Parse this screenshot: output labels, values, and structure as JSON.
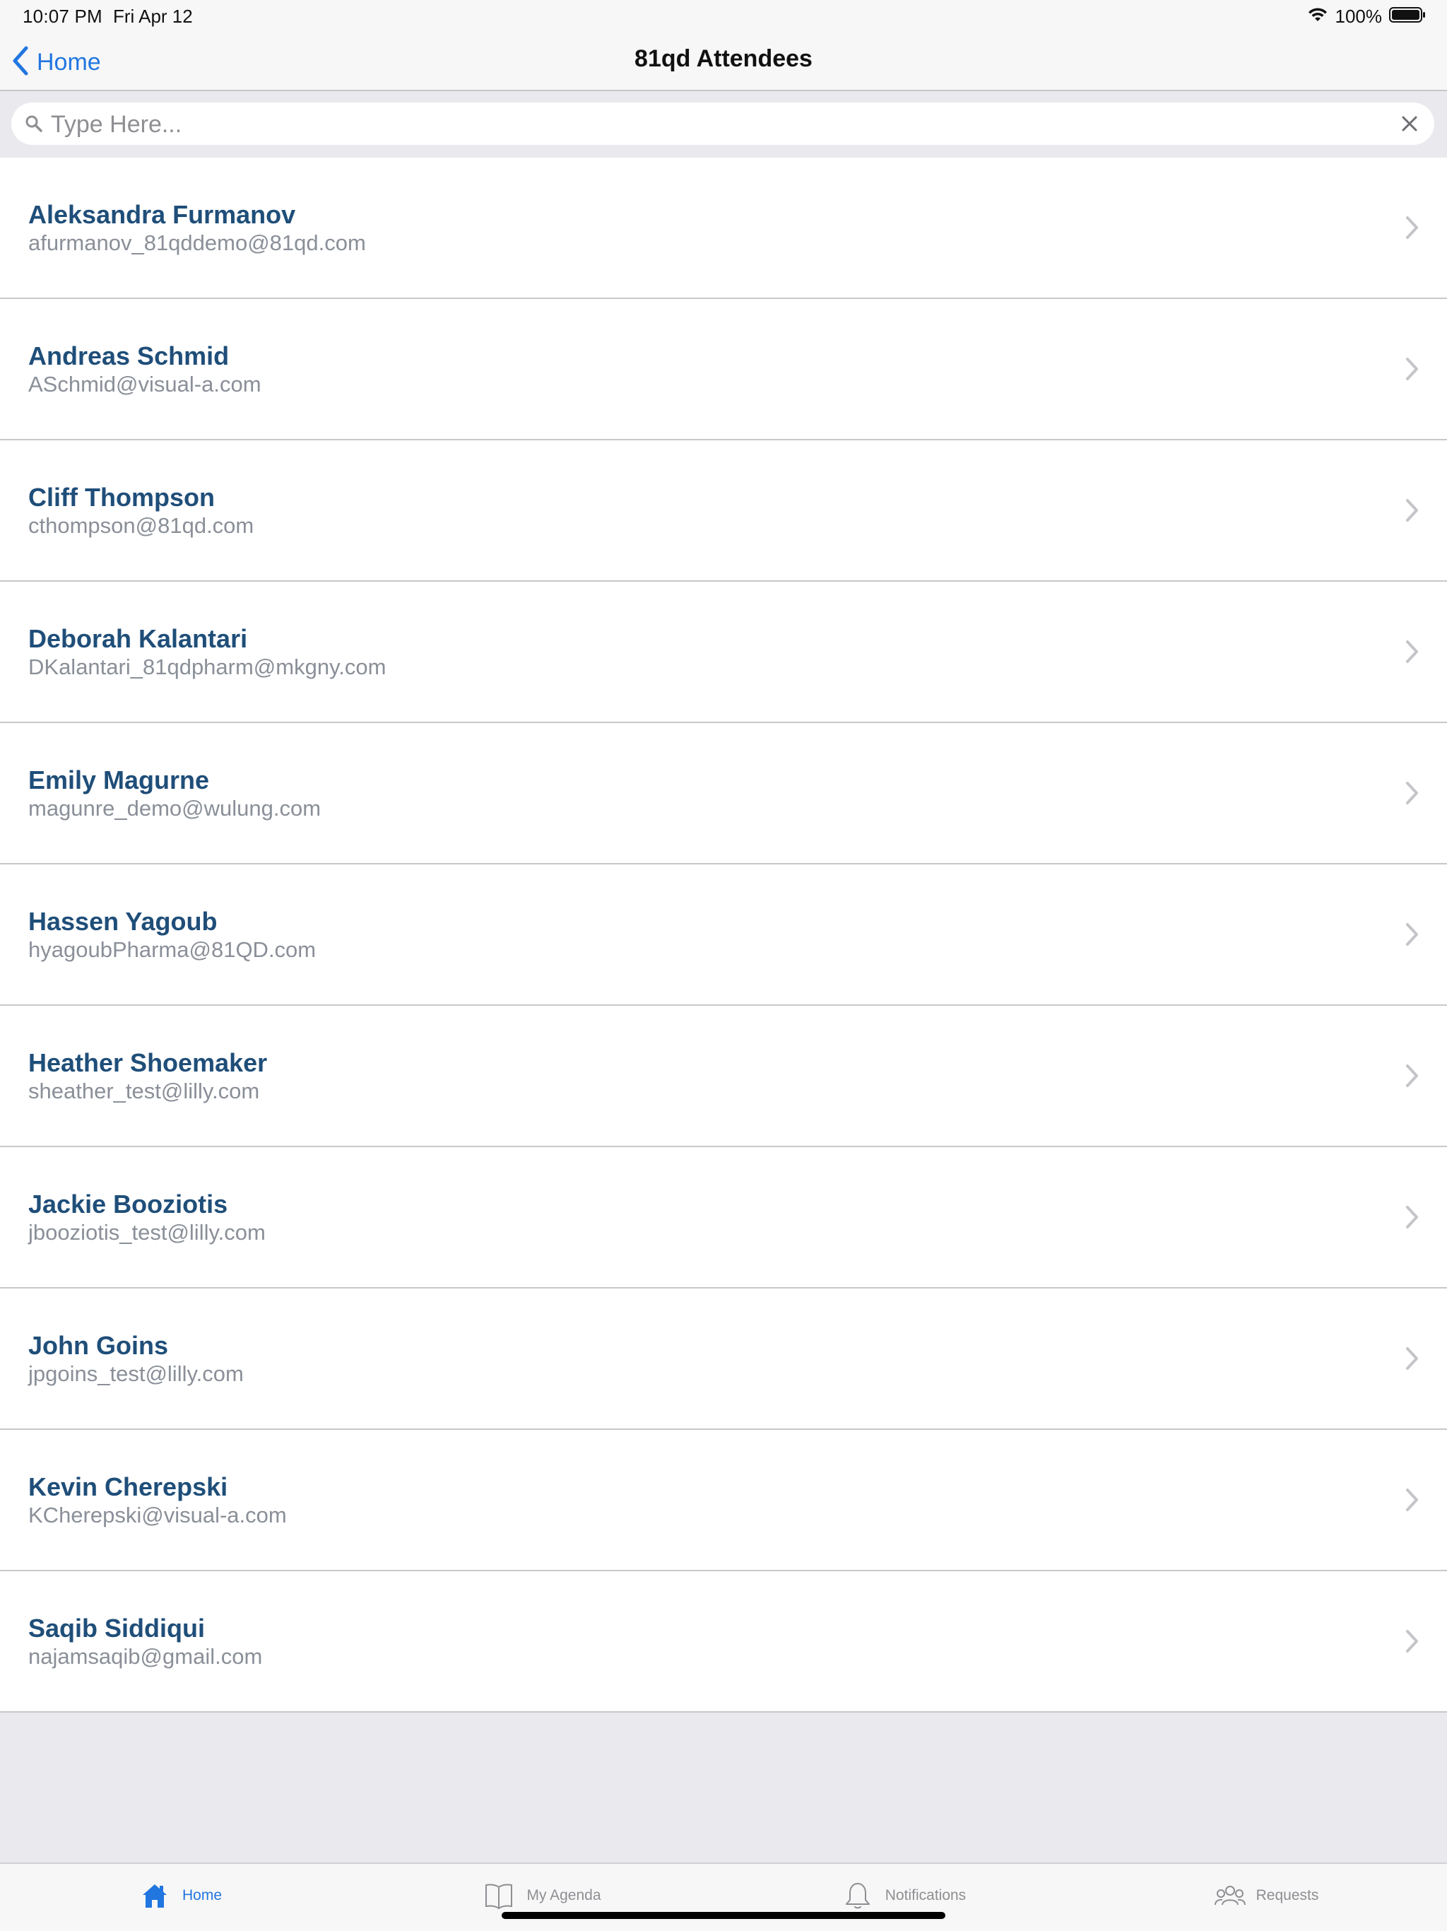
{
  "status_bar": {
    "time": "10:07 PM",
    "date": "Fri Apr 12",
    "battery_percent": "100%",
    "wifi_icon": "wifi-icon",
    "battery_icon": "battery-icon"
  },
  "nav": {
    "back_label": "Home",
    "back_icon": "chevron-left-icon",
    "title": "81qd Attendees"
  },
  "search": {
    "placeholder": "Type Here...",
    "value": "",
    "search_icon": "search-icon",
    "clear_icon": "close-icon"
  },
  "attendees": [
    {
      "name": "Aleksandra Furmanov",
      "email": "afurmanov_81qddemo@81qd.com"
    },
    {
      "name": "Andreas Schmid",
      "email": "ASchmid@visual-a.com"
    },
    {
      "name": "Cliff Thompson",
      "email": "cthompson@81qd.com"
    },
    {
      "name": "Deborah Kalantari",
      "email": "DKalantari_81qdpharm@mkgny.com"
    },
    {
      "name": "Emily Magurne",
      "email": "magunre_demo@wulung.com"
    },
    {
      "name": "Hassen Yagoub",
      "email": "hyagoubPharma@81QD.com"
    },
    {
      "name": "Heather Shoemaker",
      "email": "sheather_test@lilly.com"
    },
    {
      "name": "Jackie Booziotis",
      "email": "jbooziotis_test@lilly.com"
    },
    {
      "name": "John Goins",
      "email": "jpgoins_test@lilly.com"
    },
    {
      "name": "Kevin Cherepski",
      "email": "KCherepski@visual-a.com"
    },
    {
      "name": "Saqib Siddiqui",
      "email": "najamsaqib@gmail.com"
    }
  ],
  "tab_bar": {
    "tabs": [
      {
        "label": "Home",
        "icon": "home-icon",
        "active": true
      },
      {
        "label": "My Agenda",
        "icon": "book-icon",
        "active": false
      },
      {
        "label": "Notifications",
        "icon": "bell-icon",
        "active": false
      },
      {
        "label": "Requests",
        "icon": "people-icon",
        "active": false
      }
    ]
  },
  "colors": {
    "accent": "#2176e0",
    "name_text": "#1f4e79",
    "email_text": "#8a8f98",
    "separator": "#c8c8cc",
    "background": "#e9e9ee"
  }
}
